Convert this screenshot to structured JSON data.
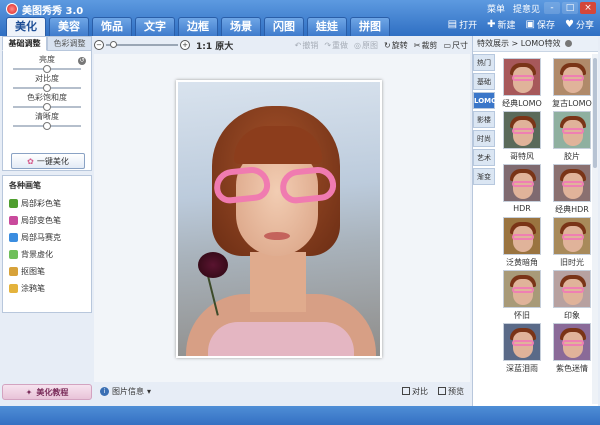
{
  "app": {
    "title": "美图秀秀 3.0"
  },
  "window": {
    "links": [
      "菜单",
      "提意见"
    ],
    "controls": [
      "-",
      "□",
      "×"
    ]
  },
  "tabs": [
    {
      "label": "美化",
      "active": true
    },
    {
      "label": "美容",
      "active": false
    },
    {
      "label": "饰品",
      "active": false
    },
    {
      "label": "文字",
      "active": false
    },
    {
      "label": "边框",
      "active": false
    },
    {
      "label": "场景",
      "active": false
    },
    {
      "label": "闪图",
      "active": false
    },
    {
      "label": "娃娃",
      "active": false
    },
    {
      "label": "拼图",
      "active": false
    }
  ],
  "top_actions": [
    {
      "label": "打开",
      "icon": "folder-icon"
    },
    {
      "label": "新建",
      "icon": "new-icon"
    },
    {
      "label": "保存",
      "icon": "save-icon"
    },
    {
      "label": "分享",
      "icon": "share-icon"
    }
  ],
  "left_panel": {
    "tabs": [
      "基础调整",
      "色彩调整"
    ],
    "active_tab": 0,
    "sliders": [
      {
        "label": "亮度",
        "value": 0.5
      },
      {
        "label": "对比度",
        "value": 0.5
      },
      {
        "label": "色彩饱和度",
        "value": 0.5
      },
      {
        "label": "清晰度",
        "value": 0.5
      }
    ],
    "one_click_label": "一键美化",
    "brushes_title": "各种画笔",
    "brushes": [
      {
        "label": "局部彩色笔",
        "color": "#4f9e2f"
      },
      {
        "label": "局部变色笔",
        "color": "#c94a9c"
      },
      {
        "label": "局部马赛克",
        "color": "#3b8de0"
      },
      {
        "label": "背景虚化",
        "color": "#6fbf5a"
      },
      {
        "label": "抠图笔",
        "color": "#d7a23a"
      },
      {
        "label": "涂鸦笔",
        "color": "#e4b33c"
      }
    ],
    "tutorial_label": "美化教程"
  },
  "center": {
    "zoom_value": 0.05,
    "actual_size": "1:1 原大",
    "edit_tools": [
      {
        "label": "撤销",
        "enabled": false
      },
      {
        "label": "重做",
        "enabled": false
      },
      {
        "label": "原图",
        "enabled": false
      },
      {
        "label": "旋转",
        "enabled": true
      },
      {
        "label": "裁剪",
        "enabled": true
      },
      {
        "label": "尺寸",
        "enabled": true
      }
    ],
    "status": {
      "info_label": "图片信息",
      "compare_label": "对比",
      "preview_label": "预览"
    }
  },
  "right_panel": {
    "header": "特效展示 > LOMO特效",
    "categories": [
      {
        "label": "热门",
        "active": false
      },
      {
        "label": "基础",
        "active": false
      },
      {
        "label": "LOMO",
        "active": true
      },
      {
        "label": "影楼",
        "active": false
      },
      {
        "label": "时尚",
        "active": false
      },
      {
        "label": "艺术",
        "active": false
      },
      {
        "label": "渐变",
        "active": false
      }
    ],
    "effects": [
      {
        "label": "经典LOMO",
        "bg": "#a7585a"
      },
      {
        "label": "复古LOMO",
        "bg": "#b08a6a"
      },
      {
        "label": "哥特风",
        "bg": "#5a6a5a"
      },
      {
        "label": "胶片",
        "bg": "#8fb0a0"
      },
      {
        "label": "HDR",
        "bg": "#7f6a70"
      },
      {
        "label": "经典HDR",
        "bg": "#8a7070"
      },
      {
        "label": "泛黄暗角",
        "bg": "#9a7440"
      },
      {
        "label": "旧时光",
        "bg": "#a88a5a"
      },
      {
        "label": "怀旧",
        "bg": "#a89a78"
      },
      {
        "label": "印象",
        "bg": "#b7a1a0"
      },
      {
        "label": "深蓝泪雨",
        "bg": "#5a6a88"
      },
      {
        "label": "紫色迷情",
        "bg": "#8a6a98"
      }
    ]
  }
}
